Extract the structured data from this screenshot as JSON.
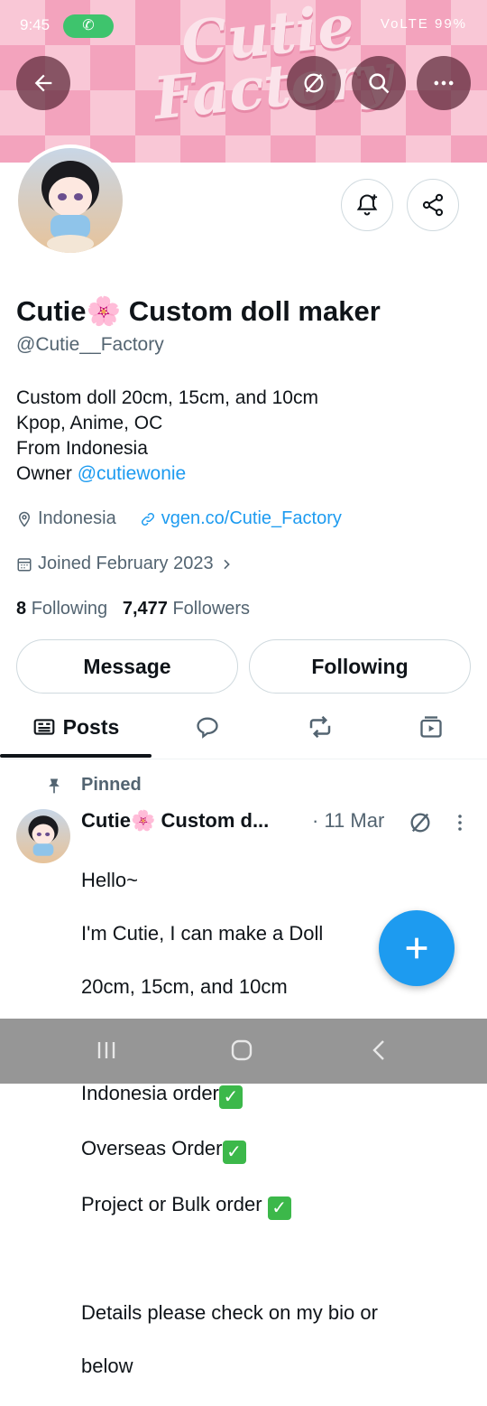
{
  "status_bar": {
    "time": "9:45",
    "indicators": "VoLTE 99%"
  },
  "banner": {
    "title_line1": "Cutie",
    "title_line2": "Factory",
    "bg_color": "#f9c7d6",
    "accent": "#f3a3bd"
  },
  "profile": {
    "name": "Cutie🌸 Custom doll maker",
    "handle": "@Cutie__Factory",
    "bio_lines": [
      "Custom doll 20cm, 15cm, and 10cm",
      "Kpop, Anime, OC",
      "From Indonesia"
    ],
    "owner_prefix": "Owner ",
    "owner_link": "@cutiewonie",
    "location": "Indonesia",
    "website": "vgen.co/Cutie_Factory",
    "joined": "Joined February 2023",
    "following_count": "8",
    "following_label": "Following",
    "followers_count": "7,477",
    "followers_label": "Followers"
  },
  "buttons": {
    "message": "Message",
    "following": "Following"
  },
  "tabs": {
    "posts": "Posts"
  },
  "post": {
    "pinned_label": "Pinned",
    "author": "Cutie🌸 Custom d...",
    "date": "· 11 Mar",
    "line1": "Hello~",
    "line2": "I'm Cutie, I can make a Doll",
    "line3": "20cm, 15cm, and 10cm",
    "order1": "Indonesia order",
    "order2": "Overseas Order",
    "order3": "Project or Bulk order",
    "line_details": "Details please check on my bio or",
    "line_last": "below"
  },
  "colors": {
    "accent_blue": "#1d9bf0",
    "muted": "#536471",
    "check_green": "#3cb84a"
  }
}
